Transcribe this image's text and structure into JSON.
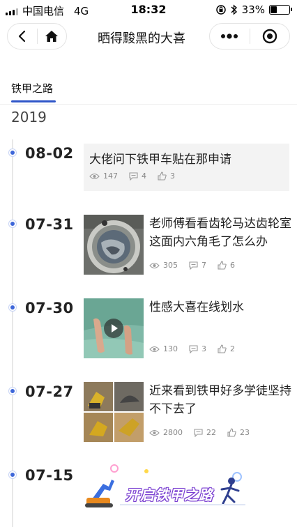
{
  "status_bar": {
    "carrier": "中国电信",
    "network": "4G",
    "time": "18:32",
    "battery": "33%",
    "battery_level": 0.33
  },
  "nav": {
    "title": "晒得黢黑的大喜",
    "back_icon": "chevron-left-icon",
    "home_icon": "home-icon",
    "more_icon": "more-dots-icon",
    "target_icon": "close-target-icon"
  },
  "tabs": [
    {
      "label": "铁甲之路",
      "active": true
    }
  ],
  "year": "2019",
  "posts": [
    {
      "date": "08-02",
      "title": "大佬问下铁甲车贴在那申请",
      "views": "147",
      "comments": "4",
      "likes": "3",
      "media": "none"
    },
    {
      "date": "07-31",
      "title": "老师傅看看齿轮马达齿轮室这面内六角毛了怎么办",
      "views": "305",
      "comments": "7",
      "likes": "6",
      "media": "image"
    },
    {
      "date": "07-30",
      "title": "性感大喜在线划水",
      "views": "130",
      "comments": "3",
      "likes": "2",
      "media": "video"
    },
    {
      "date": "07-27",
      "title": "近来看到铁甲好多学徒坚持不下去了",
      "views": "2800",
      "comments": "22",
      "likes": "23",
      "media": "image"
    },
    {
      "date": "07-15",
      "banner_text": "开启铁甲之路",
      "media": "banner"
    }
  ],
  "colors": {
    "accent": "#2f56c8",
    "dot": "#3d66d9",
    "card_bg": "#f3f3f3"
  }
}
